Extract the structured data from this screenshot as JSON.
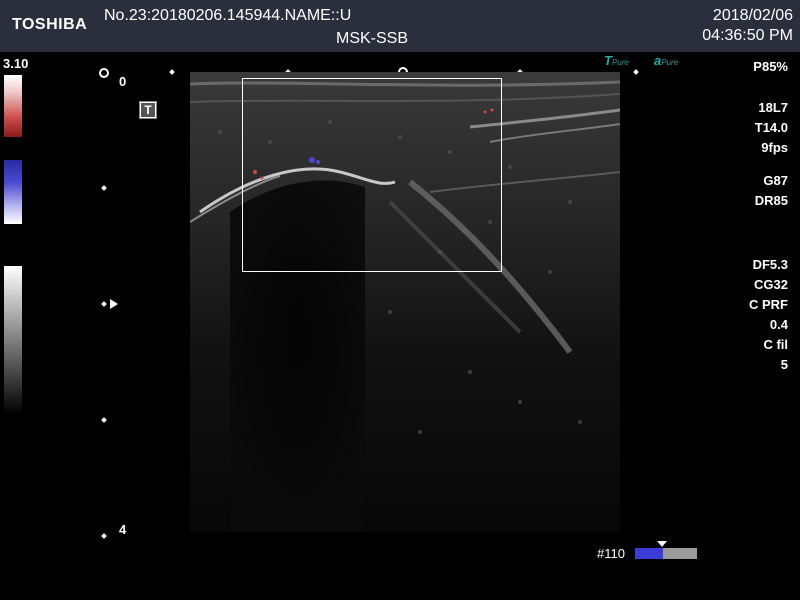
{
  "header": {
    "brand": "TOSHIBA",
    "patient": "No.23:20180206.145944.NAME::U",
    "preset": "MSK-SSB",
    "date": "2018/02/06",
    "time": "04:36:50 PM"
  },
  "left_panel": {
    "scale_value": "3.10",
    "depth_top": "0",
    "depth_bottom": "4",
    "t_button": "T"
  },
  "logos": {
    "first": {
      "mark": "T",
      "label": "Pure"
    },
    "second": {
      "mark": "a",
      "label": "Pure"
    }
  },
  "params": [
    "P85%",
    "18L7",
    "T14.0",
    "9fps",
    "G87",
    "DR85",
    "DF5.3",
    "CG32",
    "C PRF",
    "0.4",
    "C fil",
    "5"
  ],
  "footer": {
    "frame_label": "#110",
    "cine_progress": 0.45
  },
  "colors": {
    "header_bg": "#2b2f3d",
    "doppler_red": "#cc4a4a",
    "doppler_blue": "#4a4ad0",
    "cine_blue": "#3b3bd8"
  }
}
